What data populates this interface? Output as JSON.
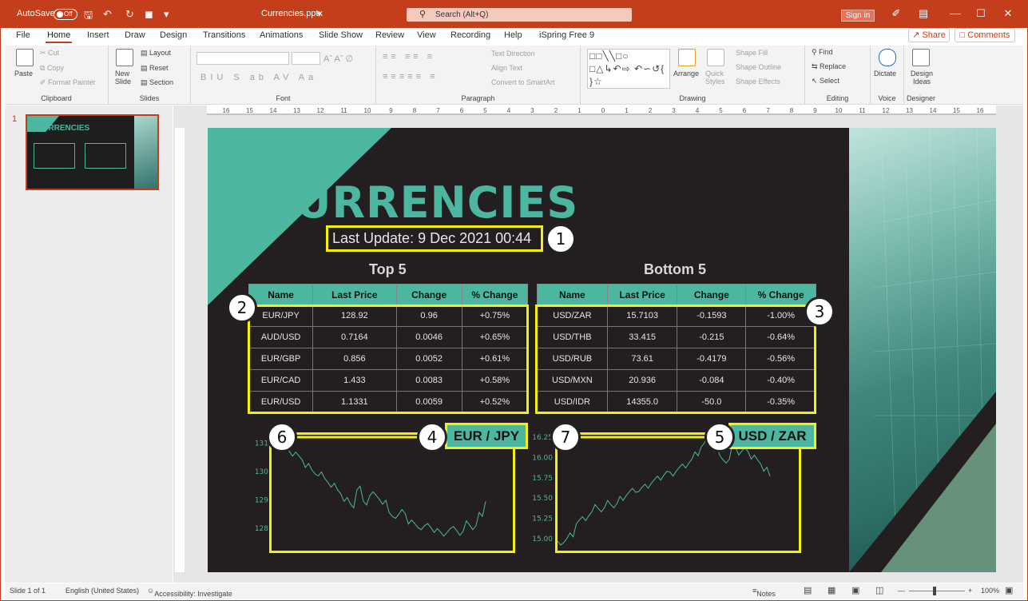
{
  "titlebar": {
    "autosave_label": "AutoSave",
    "autosave_state": "Off",
    "filename": "Currencies.pptx",
    "search_placeholder": "Search (Alt+Q)",
    "signin": "Sign in"
  },
  "tabs": [
    "File",
    "Home",
    "Insert",
    "Draw",
    "Design",
    "Transitions",
    "Animations",
    "Slide Show",
    "Review",
    "View",
    "Recording",
    "Help",
    "iSpring Free 9"
  ],
  "active_tab": "Home",
  "share": "Share",
  "comments": "Comments",
  "ribbon": {
    "clipboard": {
      "label": "Clipboard",
      "paste": "Paste",
      "cut": "Cut",
      "copy": "Copy",
      "format_painter": "Format Painter"
    },
    "slides": {
      "label": "Slides",
      "new_slide": "New Slide",
      "layout": "Layout",
      "reset": "Reset",
      "section": "Section"
    },
    "font": {
      "label": "Font"
    },
    "paragraph": {
      "label": "Paragraph",
      "text_direction": "Text Direction",
      "align_text": "Align Text",
      "convert": "Convert to SmartArt"
    },
    "drawing": {
      "label": "Drawing",
      "arrange": "Arrange",
      "quick_styles": "Quick Styles",
      "shape_fill": "Shape Fill",
      "shape_outline": "Shape Outline",
      "shape_effects": "Shape Effects"
    },
    "editing": {
      "label": "Editing",
      "find": "Find",
      "replace": "Replace",
      "select": "Select"
    },
    "voice": {
      "label": "Voice",
      "dictate": "Dictate"
    },
    "designer": {
      "label": "Designer",
      "design_ideas": "Design Ideas"
    }
  },
  "thumbnail": {
    "number": "1",
    "title": "CURRENCIES"
  },
  "slide": {
    "title": "CURRENCIES",
    "last_update": "Last Update: 9 Dec 2021 00:44",
    "top": {
      "heading": "Top 5",
      "columns": [
        "Name",
        "Last Price",
        "Change",
        "% Change"
      ],
      "rows": [
        [
          "EUR/JPY",
          "128.92",
          "0.96",
          "+0.75%"
        ],
        [
          "AUD/USD",
          "0.7164",
          "0.0046",
          "+0.65%"
        ],
        [
          "EUR/GBP",
          "0.856",
          "0.0052",
          "+0.61%"
        ],
        [
          "EUR/CAD",
          "1.433",
          "0.0083",
          "+0.58%"
        ],
        [
          "EUR/USD",
          "1.1331",
          "0.0059",
          "+0.52%"
        ]
      ]
    },
    "bottom": {
      "heading": "Bottom 5",
      "columns": [
        "Name",
        "Last Price",
        "Change",
        "% Change"
      ],
      "rows": [
        [
          "USD/ZAR",
          "15.7103",
          "-0.1593",
          "-1.00%"
        ],
        [
          "USD/THB",
          "33.415",
          "-0.215",
          "-0.64%"
        ],
        [
          "USD/RUB",
          "73.61",
          "-0.4179",
          "-0.56%"
        ],
        [
          "USD/MXN",
          "20.936",
          "-0.084",
          "-0.40%"
        ],
        [
          "USD/IDR",
          "14355.0",
          "-50.0",
          "-0.35%"
        ]
      ]
    },
    "callouts": [
      "1",
      "2",
      "3",
      "4",
      "5",
      "6",
      "7"
    ]
  },
  "chart_data": [
    {
      "type": "line",
      "pair": "EUR / JPY",
      "color": "#4db6a0",
      "yticks": [
        "131",
        "130",
        "129",
        "128"
      ],
      "ylim": [
        127.4,
        131.3
      ],
      "values": [
        131.1,
        131.0,
        130.8,
        130.6,
        130.5,
        130.2,
        130.0,
        129.9,
        129.7,
        129.5,
        129.3,
        129.0,
        128.8,
        129.4,
        128.9,
        129.2,
        129.1,
        128.9,
        128.5,
        128.4,
        128.6,
        128.2,
        128.1,
        128.0,
        128.1,
        127.9,
        127.8,
        127.9,
        128.0,
        127.8,
        128.2,
        128.0,
        128.5,
        129.0
      ]
    },
    {
      "type": "line",
      "pair": "USD / ZAR",
      "color": "#4db6a0",
      "yticks": [
        "16.25",
        "16.00",
        "15.75",
        "15.50",
        "15.25",
        "15.00"
      ],
      "ylim": [
        14.92,
        16.28
      ],
      "values": [
        14.95,
        14.97,
        15.05,
        15.2,
        15.25,
        15.3,
        15.4,
        15.35,
        15.45,
        15.4,
        15.5,
        15.55,
        15.6,
        15.6,
        15.65,
        15.7,
        15.75,
        15.8,
        15.8,
        15.85,
        15.9,
        15.95,
        16.05,
        16.15,
        16.25,
        16.1,
        16.0,
        15.95,
        16.15,
        16.05,
        16.1,
        16.0,
        15.95,
        15.85,
        15.75
      ]
    }
  ],
  "status": {
    "slide": "Slide 1 of 1",
    "language": "English (United States)",
    "accessibility": "Accessibility: Investigate",
    "notes": "Notes",
    "zoom": "100%"
  }
}
